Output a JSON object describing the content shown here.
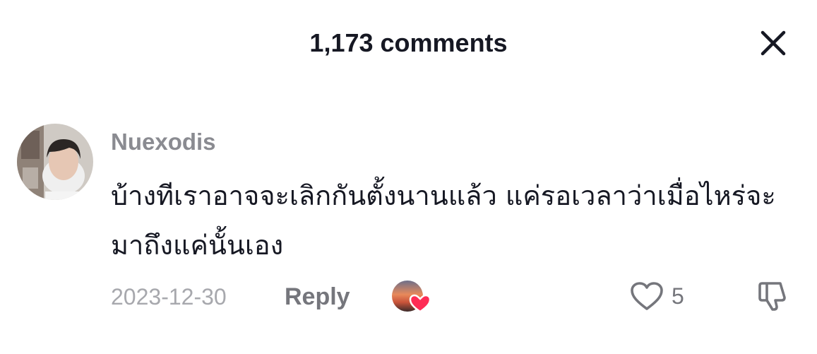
{
  "header": {
    "title": "1,173 comments",
    "close_icon": "close-icon"
  },
  "comment": {
    "username": "Nuexodis",
    "text": "บ้างทีเราอาจจะเลิกกันตั้งนานแล้ว แค่รอเวลาว่าเมื่อไหร่จะมาถึงแค่นั้นเอง",
    "date": "2023-12-30",
    "reply_label": "Reply",
    "like_count": "5",
    "creator_liked_icon": "creator-liked-heart-icon",
    "like_icon": "heart-outline-icon",
    "dislike_icon": "thumbs-down-icon"
  },
  "colors": {
    "primary_text": "#161823",
    "secondary_text": "#8a8b91",
    "muted_text": "#a7a8ad",
    "heart_accent": "#fe2c55"
  }
}
